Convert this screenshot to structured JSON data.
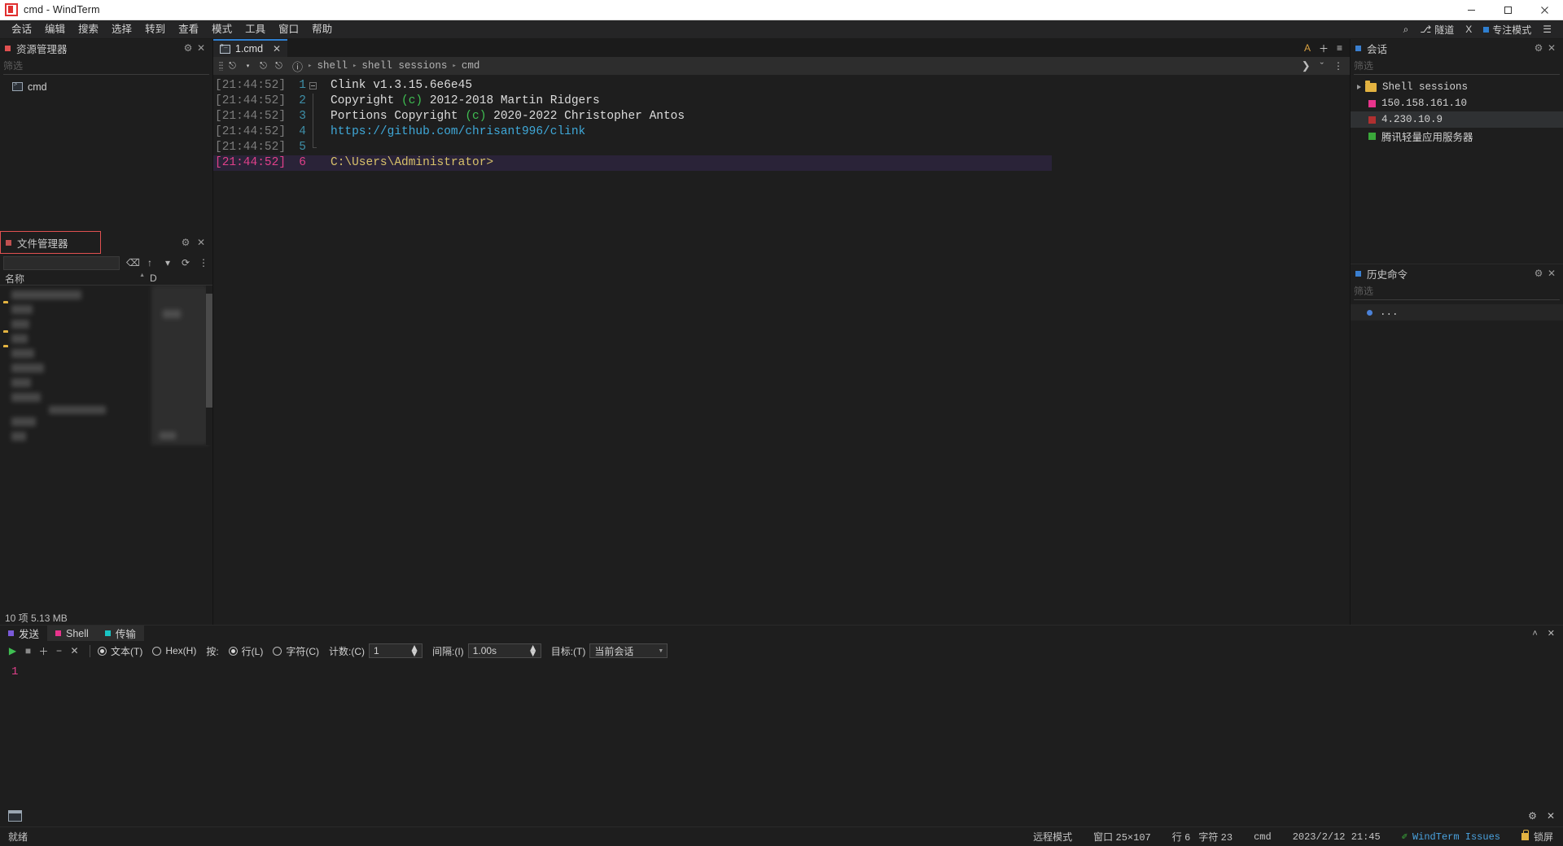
{
  "window": {
    "title": "cmd - WindTerm",
    "minimize": "─",
    "maximize": "□",
    "close": "✕"
  },
  "menubar": {
    "items": [
      {
        "label": "会话"
      },
      {
        "label": "编辑"
      },
      {
        "label": "搜索"
      },
      {
        "label": "选择"
      },
      {
        "label": "转到"
      },
      {
        "label": "查看"
      },
      {
        "label": "模式"
      },
      {
        "label": "工具"
      },
      {
        "label": "窗口"
      },
      {
        "label": "帮助"
      }
    ],
    "right": {
      "search_icon": "⌕",
      "tunnel_label": "隧道",
      "tunnel_icon": "⎇",
      "x_label": "X",
      "focus_label": "专注模式",
      "menu_icon": "☰"
    }
  },
  "explorer": {
    "title": "资源管理器",
    "dot_color": "#e05050",
    "filter_placeholder": "筛选",
    "settings_icon": "⚙",
    "close_icon": "✕",
    "items": [
      {
        "label": "cmd",
        "icon": "cmd-icon"
      }
    ]
  },
  "file_manager": {
    "title": "文件管理器",
    "dot_color": "#c05050",
    "settings_icon": "⚙",
    "close_icon": "✕",
    "toolbar": {
      "back_icon": "⌫",
      "up_icon": "↑",
      "dropdown_icon": "▾",
      "refresh_icon": "⟳",
      "more_icon": "⋮"
    },
    "columns": [
      "名称",
      "D"
    ],
    "status": "10 项 5.13 MB"
  },
  "tabs": {
    "items": [
      {
        "label": "1.cmd",
        "icon": "terminal-icon",
        "active": true,
        "close": "✕"
      }
    ],
    "right": {
      "font_icon": "A",
      "add_icon": "＋",
      "list_icon": "≡"
    }
  },
  "breadcrumb": {
    "info_icon": "ⓘ",
    "lead_sep": "▸",
    "items": [
      "shell",
      "shell sessions",
      "cmd"
    ],
    "separator": "▸",
    "run_icon": "❯",
    "chevron_icon": "ˇ",
    "more_icon": "⋮",
    "tools": {
      "new_icon": "⎋",
      "caret_icon": "▾",
      "close_tab_icon": "⎋",
      "zero_icon": "⎋"
    }
  },
  "terminal": {
    "lines": [
      {
        "ts": "[21:44:52]",
        "num": "1",
        "fold": "start",
        "segments": [
          {
            "t": "Clink v1.3.15.6e6e45",
            "c": "plain"
          }
        ]
      },
      {
        "ts": "[21:44:52]",
        "num": "2",
        "fold": "mid",
        "segments": [
          {
            "t": "Copyright ",
            "c": "plain"
          },
          {
            "t": "(c)",
            "c": "green"
          },
          {
            "t": " 2012-2018 Martin Ridgers",
            "c": "plain"
          }
        ]
      },
      {
        "ts": "[21:44:52]",
        "num": "3",
        "fold": "mid",
        "segments": [
          {
            "t": "Portions Copyright ",
            "c": "plain"
          },
          {
            "t": "(c)",
            "c": "green"
          },
          {
            "t": " 2020-2022 Christopher Antos",
            "c": "plain"
          }
        ]
      },
      {
        "ts": "[21:44:52]",
        "num": "4",
        "fold": "mid",
        "segments": [
          {
            "t": "https://github.com/chrisant996/clink",
            "c": "blue"
          }
        ]
      },
      {
        "ts": "[21:44:52]",
        "num": "5",
        "fold": "end",
        "segments": [
          {
            "t": "",
            "c": "plain"
          }
        ]
      },
      {
        "ts": "[21:44:52]",
        "num": "6",
        "fold": "none",
        "active": true,
        "segments": [
          {
            "t": "C:\\Users\\Administrator>",
            "c": "yellow"
          }
        ]
      }
    ]
  },
  "sessions": {
    "title": "会话",
    "dot_color": "#3a7fd0",
    "settings_icon": "⚙",
    "close_icon": "✕",
    "filter_placeholder": "筛选",
    "items": [
      {
        "label": "Shell sessions",
        "type": "folder",
        "arrow": "▸"
      },
      {
        "label": "150.158.161.10",
        "type": "item",
        "color": "#e8348c"
      },
      {
        "label": "4.230.10.9",
        "type": "item",
        "color": "#b03030",
        "selected": true
      },
      {
        "label": "腾讯轻量应用服务器",
        "type": "item",
        "color": "#3aa83a"
      }
    ]
  },
  "history": {
    "title": "历史命令",
    "dot_color": "#3a7fd0",
    "settings_icon": "⚙",
    "close_icon": "✕",
    "filter_placeholder": "筛选",
    "items": [
      {
        "label": "..."
      }
    ]
  },
  "send_panel": {
    "tabs": [
      {
        "label": "发送",
        "dot": "#7a5ad8",
        "active": true
      },
      {
        "label": "Shell",
        "dot": "#e8348c",
        "boxed": true
      },
      {
        "label": "传输",
        "dot": "#19c4c4",
        "boxed": true
      }
    ],
    "collapse_icon": "˄",
    "close_icon": "✕",
    "toolbar": {
      "play_icon": "▶",
      "stop_icon": "■",
      "add_icon": "＋",
      "remove_icon": "−",
      "clear_icon": "✕",
      "mode_text_label": "文本(T)",
      "mode_hex_label": "Hex(H)",
      "by_label": "按:",
      "by_line_label": "行(L)",
      "by_char_label": "字符(C)",
      "count_label": "计数:(C)",
      "count_value": "1",
      "interval_label": "间隔:(I)",
      "interval_value": "1.00s",
      "target_label": "目标:(T)",
      "target_value": "当前会话",
      "mode_selected": "text",
      "by_selected": "line"
    },
    "editor_content": "1"
  },
  "bottom_bar": {
    "terminal_icon": "terminal-icon",
    "settings_icon": "⚙",
    "close_icon": "✕"
  },
  "statusbar": {
    "ready": "就绪",
    "remote_mode": "远程模式",
    "window_label": "窗口",
    "window_size": "25×107",
    "row_label": "行",
    "row_value": "6",
    "char_label": "字符",
    "char_value": "23",
    "shell": "cmd",
    "datetime": "2023/2/12 21:45",
    "issues_link": "WindTerm Issues",
    "issues_icon": "✐",
    "lock_label": "锁屏"
  }
}
